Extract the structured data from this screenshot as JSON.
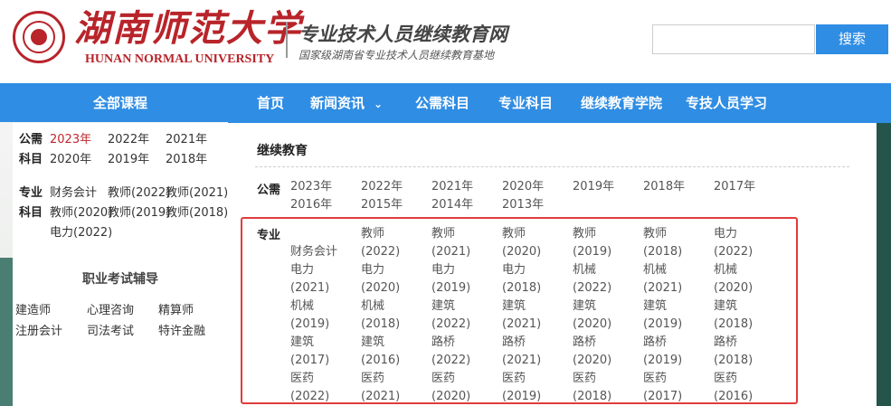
{
  "header": {
    "university_cn": "湖南师范大学",
    "university_en": "HUNAN NORMAL UNIVERSITY",
    "site_title": "专业技术人员继续教育网",
    "site_subtitle": "国家级湖南省专业技术人员继续教育基地",
    "search_placeholder": "",
    "search_label": "搜索",
    "brand_color": "#b8242a"
  },
  "nav": {
    "all_courses": "全部课程",
    "items": [
      "首页",
      "新闻资讯",
      "公需科目",
      "专业科目",
      "继续教育学院",
      "专技人员学习"
    ],
    "chevron": "⌄",
    "color": "#2f8de4"
  },
  "sidebar": {
    "public_label": "公需科目",
    "public_label_1": "公需",
    "public_label_2": "科目",
    "public_years": [
      "2023年",
      "2022年",
      "2021年",
      "2020年",
      "2019年",
      "2018年"
    ],
    "pro_label_1": "专业",
    "pro_label_2": "科目",
    "pro_items": [
      "财务会计",
      "教师(2022)",
      "教师(2021)",
      "教师(2020)",
      "教师(2019)",
      "教师(2018)",
      "电力(2022)"
    ],
    "career_title": "职业考试辅导",
    "career_items": [
      "建造师",
      "心理咨询",
      "精算师",
      "注册会计",
      "司法考试",
      "特许金融"
    ]
  },
  "main": {
    "section_title": "继续教育",
    "public_label": "公需",
    "public_years": [
      "2023年",
      "2022年",
      "2021年",
      "2020年",
      "2019年",
      "2018年",
      "2017年",
      "2016年",
      "2015年",
      "2014年",
      "2013年"
    ],
    "pro_label": "专业",
    "pro_cells": [
      [
        "",
        "教师",
        "教师",
        "教师",
        "教师",
        "教师",
        "电力"
      ],
      [
        "财务会计",
        "(2022)",
        "(2021)",
        "(2020)",
        "(2019)",
        "(2018)",
        "(2022)"
      ],
      [
        "电力",
        "电力",
        "电力",
        "电力",
        "机械",
        "机械",
        "机械"
      ],
      [
        "(2021)",
        "(2020)",
        "(2019)",
        "(2018)",
        "(2022)",
        "(2021)",
        "(2020)"
      ],
      [
        "机械",
        "机械",
        "建筑",
        "建筑",
        "建筑",
        "建筑",
        "建筑"
      ],
      [
        "(2019)",
        "(2018)",
        "(2022)",
        "(2021)",
        "(2020)",
        "(2019)",
        "(2018)"
      ],
      [
        "建筑",
        "建筑",
        "路桥",
        "路桥",
        "路桥",
        "路桥",
        "路桥"
      ],
      [
        "(2017)",
        "(2016)",
        "(2022)",
        "(2021)",
        "(2020)",
        "(2019)",
        "(2018)"
      ],
      [
        "医药",
        "医药",
        "医药",
        "医药",
        "医药",
        "医药",
        "医药"
      ],
      [
        "(2022)",
        "(2021)",
        "(2020)",
        "(2019)",
        "(2018)",
        "(2017)",
        "(2016)"
      ]
    ],
    "highlight_color": "#e03c3c"
  }
}
